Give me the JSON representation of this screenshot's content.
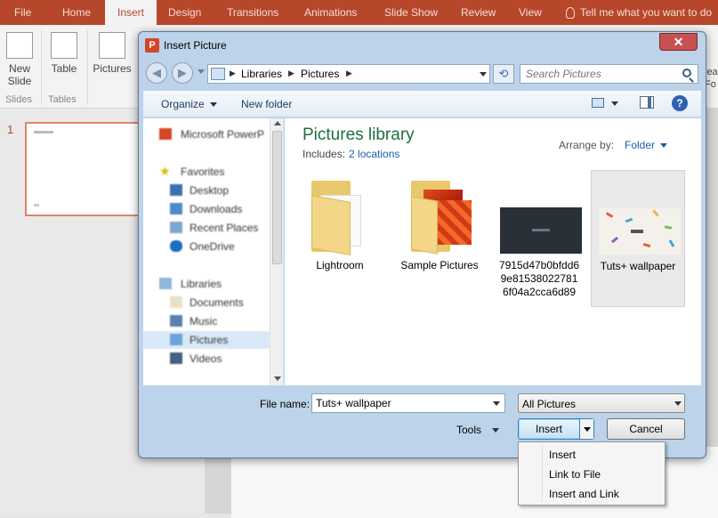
{
  "ppt": {
    "tabs": [
      "File",
      "Home",
      "Insert",
      "Design",
      "Transitions",
      "Animations",
      "Slide Show",
      "Review",
      "View"
    ],
    "active_tab": "Insert",
    "tell_me": "Tell me what you want to do",
    "ribbon": {
      "new_slide": "New Slide",
      "table": "Table",
      "pictures": "Pictures",
      "group_slides": "Slides",
      "group_tables": "Tables",
      "right_partial": "lea Fo"
    },
    "slide_number": "1"
  },
  "dialog": {
    "title": "Insert Picture",
    "close_glyph": "✕",
    "breadcrumb": [
      "Libraries",
      "Pictures"
    ],
    "search_placeholder": "Search Pictures",
    "toolbar": {
      "organize": "Organize",
      "new_folder": "New folder",
      "help": "?"
    },
    "nav": {
      "app": "Microsoft PowerP",
      "favorites": "Favorites",
      "favorites_items": [
        "Desktop",
        "Downloads",
        "Recent Places",
        "OneDrive"
      ],
      "libraries": "Libraries",
      "library_items": [
        "Documents",
        "Music",
        "Pictures",
        "Videos"
      ],
      "selected": "Pictures"
    },
    "library": {
      "title": "Pictures library",
      "includes_label": "Includes:",
      "includes_link": "2 locations",
      "arrange_label": "Arrange by:",
      "arrange_value": "Folder"
    },
    "files": [
      {
        "name": "Lightroom",
        "kind": "folder"
      },
      {
        "name": "Sample Pictures",
        "kind": "folder"
      },
      {
        "name": "7915d47b0bfdd69e815380227816f04a2cca6d89",
        "kind": "image"
      },
      {
        "name": "Tuts+ wallpaper",
        "kind": "image",
        "selected": true
      }
    ],
    "bottom": {
      "file_name_label": "File name:",
      "file_name_value": "Tuts+ wallpaper",
      "filter": "All Pictures",
      "tools": "Tools",
      "insert": "Insert",
      "cancel": "Cancel"
    },
    "insert_menu": [
      "Insert",
      "Link to File",
      "Insert and Link"
    ]
  }
}
